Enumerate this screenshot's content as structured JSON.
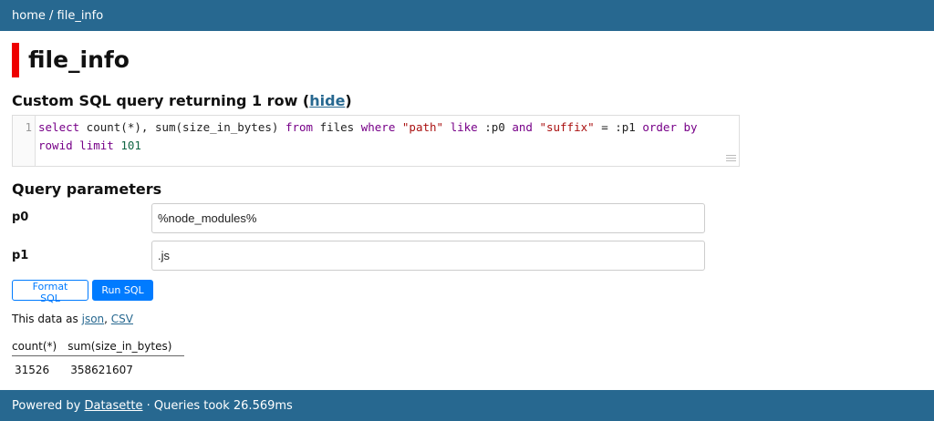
{
  "breadcrumb": {
    "home": "home",
    "separator": " / ",
    "current": "file_info"
  },
  "page_title": "file_info",
  "sql_section": {
    "heading": "Custom SQL query returning 1 row (",
    "hide_link": "hide",
    "heading_end": ")"
  },
  "editor": {
    "line_number": "1",
    "query": "select count(*), sum(size_in_bytes) from files where \"path\" like :p0 and \"suffix\" = :p1 order by rowid limit 101"
  },
  "params": {
    "heading": "Query parameters",
    "items": [
      {
        "label": "p0",
        "value": "%node_modules%"
      },
      {
        "label": "p1",
        "value": ".js"
      }
    ]
  },
  "buttons": {
    "format": "Format SQL",
    "run": "Run SQL"
  },
  "export": {
    "prefix": "This data as ",
    "json": "json",
    "sep": ", ",
    "csv": "CSV"
  },
  "results": {
    "columns": [
      "count(*)",
      "sum(size_in_bytes)"
    ],
    "rows": [
      [
        "31526",
        "358621607"
      ]
    ]
  },
  "footer": {
    "prefix": "Powered by ",
    "link": "Datasette",
    "suffix": " · Queries took 26.569ms"
  },
  "colors": {
    "bar": "#276890",
    "accent": "#ee0000",
    "primary_button": "#007bff"
  }
}
